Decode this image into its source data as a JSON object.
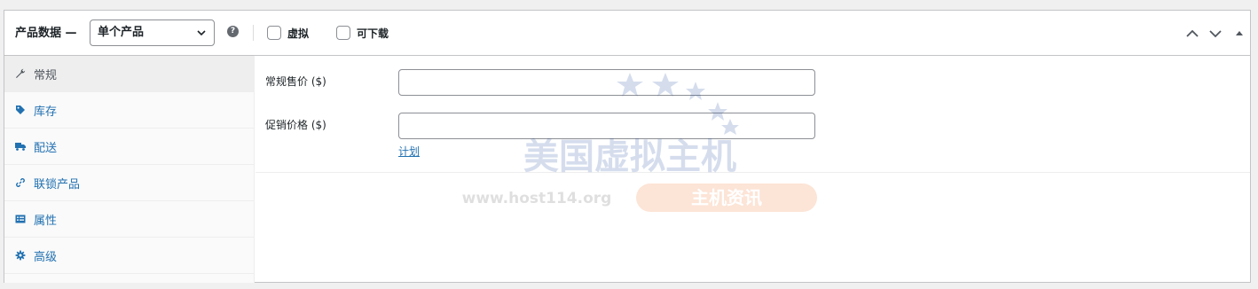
{
  "header": {
    "title": "产品数据 —",
    "product_type": {
      "selected": "单个产品"
    },
    "help_icon": "?",
    "virtual_label": "虚拟",
    "downloadable_label": "可下载",
    "icons": [
      "chevron-up-icon",
      "chevron-down-icon",
      "triangle-up-icon"
    ]
  },
  "sidebar": {
    "items": [
      {
        "label": "常规",
        "icon": "wrench-icon",
        "active": true
      },
      {
        "label": "库存",
        "icon": "tag-icon",
        "active": false
      },
      {
        "label": "配送",
        "icon": "truck-icon",
        "active": false
      },
      {
        "label": "联锁产品",
        "icon": "link-icon",
        "active": false
      },
      {
        "label": "属性",
        "icon": "list-icon",
        "active": false
      },
      {
        "label": "高级",
        "icon": "gear-icon",
        "active": false
      }
    ]
  },
  "general": {
    "regular_price_label": "常规售价 ($)",
    "regular_price_value": "",
    "sale_price_label": "促销价格 ($)",
    "sale_price_value": "",
    "schedule_link": "计划"
  },
  "watermark": {
    "title": "美国虚拟主机",
    "url": "www.host114.org",
    "badge": "主机资讯"
  },
  "colors": {
    "link": "#2271b1",
    "border": "#c3c4c7",
    "sidebar_bg": "#fafafa",
    "active_tab_bg": "#eeeeee"
  }
}
